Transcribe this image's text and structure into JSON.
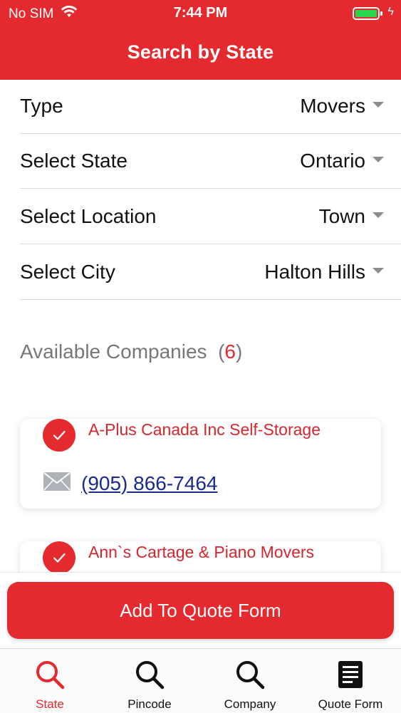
{
  "status_bar": {
    "carrier": "No SIM",
    "time": "7:44 PM"
  },
  "header": {
    "title": "Search by State"
  },
  "filters": [
    {
      "label": "Type",
      "value": "Movers"
    },
    {
      "label": "Select State",
      "value": "Ontario"
    },
    {
      "label": "Select Location",
      "value": "Town"
    },
    {
      "label": "Select City",
      "value": "Halton Hills"
    }
  ],
  "available": {
    "label": "Available Companies",
    "open": "(",
    "count": "6",
    "close": ")"
  },
  "companies": [
    {
      "name": "A-Plus Canada Inc Self-Storage",
      "phone": "(905) 866-7464"
    },
    {
      "name": "Ann`s Cartage & Piano Movers"
    }
  ],
  "cta": {
    "label": "Add To Quote Form"
  },
  "tabs": [
    {
      "label": "State",
      "icon": "search-icon"
    },
    {
      "label": "Pincode",
      "icon": "search-icon"
    },
    {
      "label": "Company",
      "icon": "search-icon"
    },
    {
      "label": "Quote Form",
      "icon": "document-icon"
    }
  ],
  "colors": {
    "brand": "#e52a2f",
    "link": "#1b2a8f",
    "battery": "#27d94a"
  }
}
